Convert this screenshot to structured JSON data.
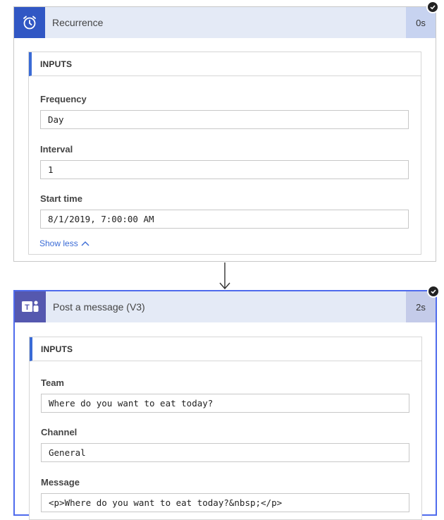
{
  "recurrence": {
    "title": "Recurrence",
    "duration": "0s",
    "inputs_heading": "INPUTS",
    "fields": [
      {
        "label": "Frequency",
        "value": "Day"
      },
      {
        "label": "Interval",
        "value": "1"
      },
      {
        "label": "Start time",
        "value": "8/1/2019, 7:00:00 AM"
      }
    ],
    "show_less": "Show less"
  },
  "post_message": {
    "title": "Post a message (V3)",
    "duration": "2s",
    "inputs_heading": "INPUTS",
    "fields": [
      {
        "label": "Team",
        "value": "Where do you want to eat today?"
      },
      {
        "label": "Channel",
        "value": "General"
      },
      {
        "label": "Message",
        "value": "<p>Where do you want to eat today?&nbsp;</p>"
      }
    ]
  },
  "colors": {
    "accent": "#3a6bd6",
    "recurrence_icon_bg": "#3157c4",
    "teams_icon_bg": "#5558af",
    "header_bg": "#e4eaf6"
  },
  "icons": {
    "recurrence": "alarm-clock-icon",
    "teams": "teams-icon",
    "status": "success-check-icon",
    "chevron": "chevron-up-icon",
    "arrow": "down-arrow-icon"
  }
}
